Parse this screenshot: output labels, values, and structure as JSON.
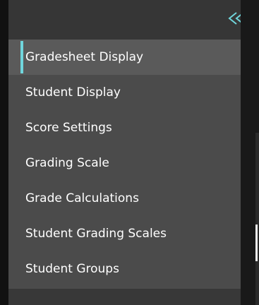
{
  "sidebar": {
    "collapse_icon": "double-chevron-left-icon",
    "accent_color": "#70d6dc",
    "items": [
      {
        "label": "Gradesheet Display"
      },
      {
        "label": "Student Display"
      },
      {
        "label": "Score Settings"
      },
      {
        "label": "Grading Scale"
      },
      {
        "label": "Grade Calculations"
      },
      {
        "label": "Student Grading Scales"
      },
      {
        "label": "Student Groups"
      }
    ],
    "active_item": "Gradesheet Display"
  }
}
